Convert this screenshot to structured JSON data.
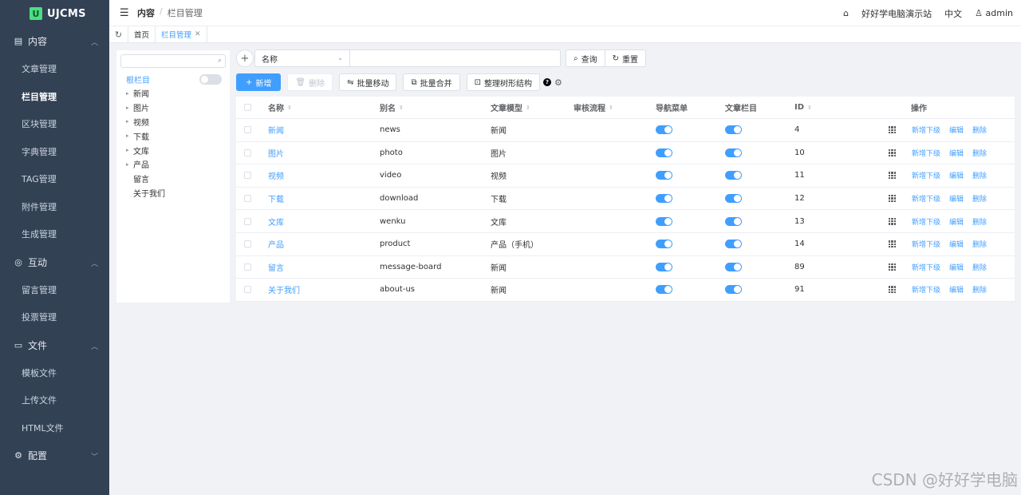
{
  "app": {
    "logo_mark": "U",
    "logo_text": "UJCMS"
  },
  "sidebar": {
    "groups": [
      {
        "label": "内容",
        "icon": "document-icon",
        "items": [
          "文章管理",
          "栏目管理",
          "区块管理",
          "字典管理",
          "TAG管理",
          "附件管理",
          "生成管理"
        ]
      },
      {
        "label": "互动",
        "icon": "chat-icon",
        "items": [
          "留言管理",
          "投票管理"
        ]
      },
      {
        "label": "文件",
        "icon": "folder-icon",
        "items": [
          "模板文件",
          "上传文件",
          "HTML文件"
        ]
      },
      {
        "label": "配置",
        "icon": "gear-icon",
        "items": []
      }
    ],
    "active_item": "栏目管理"
  },
  "header": {
    "breadcrumb": [
      "内容",
      "栏目管理"
    ],
    "site_name": "好好学电脑演示站",
    "language": "中文",
    "user": "admin"
  },
  "tabs": {
    "home": "首页",
    "current": "栏目管理"
  },
  "tree": {
    "root_label": "根栏目",
    "nodes": [
      {
        "label": "新闻",
        "has_children": true
      },
      {
        "label": "图片",
        "has_children": true
      },
      {
        "label": "视频",
        "has_children": true
      },
      {
        "label": "下载",
        "has_children": true
      },
      {
        "label": "文库",
        "has_children": true
      },
      {
        "label": "产品",
        "has_children": true
      },
      {
        "label": "留言",
        "has_children": false
      },
      {
        "label": "关于我们",
        "has_children": false
      }
    ]
  },
  "search": {
    "field": "名称",
    "query_label": "查询",
    "reset_label": "重置"
  },
  "toolbar": {
    "add": "新增",
    "delete": "删除",
    "batch_move": "批量移动",
    "batch_merge": "批量合并",
    "tidy_tree": "整理树形结构"
  },
  "table": {
    "headers": {
      "name": "名称",
      "alias": "别名",
      "model": "文章模型",
      "workflow": "审核流程",
      "nav": "导航菜单",
      "article": "文章栏目",
      "id": "ID",
      "ops": "操作"
    },
    "row_actions": {
      "add_child": "新增下级",
      "edit": "编辑",
      "delete": "删除"
    },
    "rows": [
      {
        "name": "新闻",
        "alias": "news",
        "model": "新闻",
        "id": "4",
        "nav": true,
        "article": true
      },
      {
        "name": "图片",
        "alias": "photo",
        "model": "图片",
        "id": "10",
        "nav": true,
        "article": true
      },
      {
        "name": "视频",
        "alias": "video",
        "model": "视频",
        "id": "11",
        "nav": true,
        "article": true
      },
      {
        "name": "下载",
        "alias": "download",
        "model": "下载",
        "id": "12",
        "nav": true,
        "article": true
      },
      {
        "name": "文库",
        "alias": "wenku",
        "model": "文库",
        "id": "13",
        "nav": true,
        "article": true
      },
      {
        "name": "产品",
        "alias": "product",
        "model": "产品（手机）",
        "id": "14",
        "nav": true,
        "article": true
      },
      {
        "name": "留言",
        "alias": "message-board",
        "model": "新闻",
        "id": "89",
        "nav": true,
        "article": true
      },
      {
        "name": "关于我们",
        "alias": "about-us",
        "model": "新闻",
        "id": "91",
        "nav": true,
        "article": true
      }
    ]
  },
  "watermark": "CSDN @好好学电脑",
  "colors": {
    "sidebar_bg": "#334155",
    "primary": "#409eff",
    "logo": "#4ade80"
  }
}
